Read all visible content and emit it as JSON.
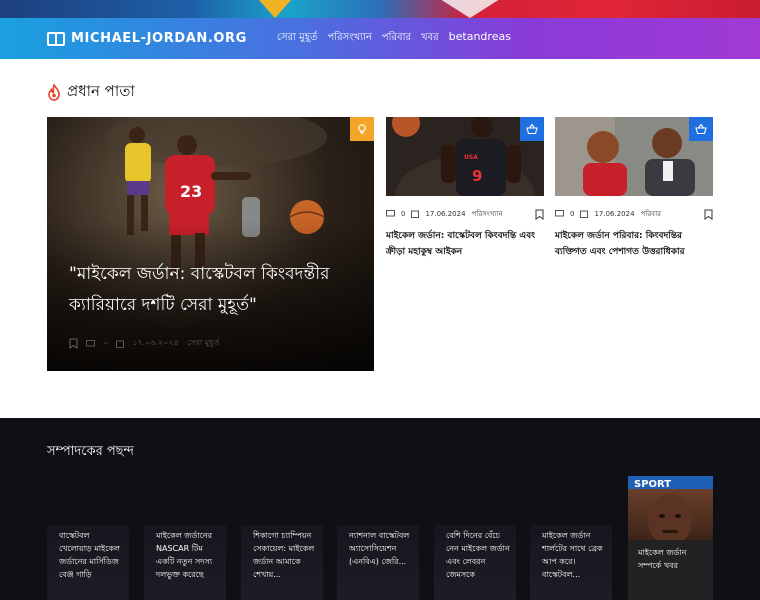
{
  "site": {
    "name": "MICHAEL-JORDAN.ORG"
  },
  "nav": [
    {
      "label": "সেরা মুহূর্ত"
    },
    {
      "label": "পরিসংখ্যান"
    },
    {
      "label": "পরিবার"
    },
    {
      "label": "খবর"
    },
    {
      "label": "betandreas"
    }
  ],
  "main": {
    "section_title": "প্রধান পাতা",
    "hero": {
      "title": "\"মাইকেল জর্ডান: বাস্কেটবল কিংবদন্তীর ক্যারিয়ারে দশটি সেরা মুহূর্ত\"",
      "comments": "০",
      "date": "১৭.০৬.২০২৪",
      "category": "সেরা মুহূর্ত"
    },
    "cards": [
      {
        "comments": "0",
        "date": "17.06.2024",
        "category": "পরিসংখ্যান",
        "title": "মাইকেল জর্ডান: বাস্কেটবল কিংবদন্তি এবং ক্রীড়া মহাকুম্ব আইকন"
      },
      {
        "comments": "0",
        "date": "17.06.2024",
        "category": "পরিবার",
        "title": "মাইকেল জর্ডান পরিবার: কিংবদন্তির ব্যক্তিগত এবং পেশাগত উত্তরাধিকার"
      }
    ]
  },
  "editors": {
    "title": "সম্পাদকের পছন্দ",
    "picks": [
      {
        "label": "বাস্কেটবল খেলোয়াড় মাইকেল জর্ডানের মার্সিডিজ বেঞ্জ গাড়ি"
      },
      {
        "label": "মাইকেল জর্ডানের NASCAR টিম একটি নতুন সদস্য দলভুক্ত করেছে"
      },
      {
        "label": "শিকাগো চ্যাম্পিয়ন সেকায়েল: মাইকেল জর্ডান আমাকে শেখায়..."
      },
      {
        "label": "ন্যাশনাল বাস্কেটবল অ্যাসোসিয়েশন (এনবিএ) জেরি..."
      },
      {
        "label": "বেশি দিনের বেঁচে নেন মাইকেল জর্ডান এবং লেবরন জেমসকে"
      },
      {
        "label": "মাইকেল জর্ডান শার্লটের সাথে ব্রেক আপ করে। বাস্কেটবল..."
      },
      {
        "label": "মাইকেল জর্ডান সম্পর্কে খবর",
        "photo_caption": "SPORT"
      }
    ]
  },
  "colors": {
    "accent_orange": "#f2a527",
    "accent_blue": "#1f6fe0",
    "fire": "#e8412b"
  }
}
